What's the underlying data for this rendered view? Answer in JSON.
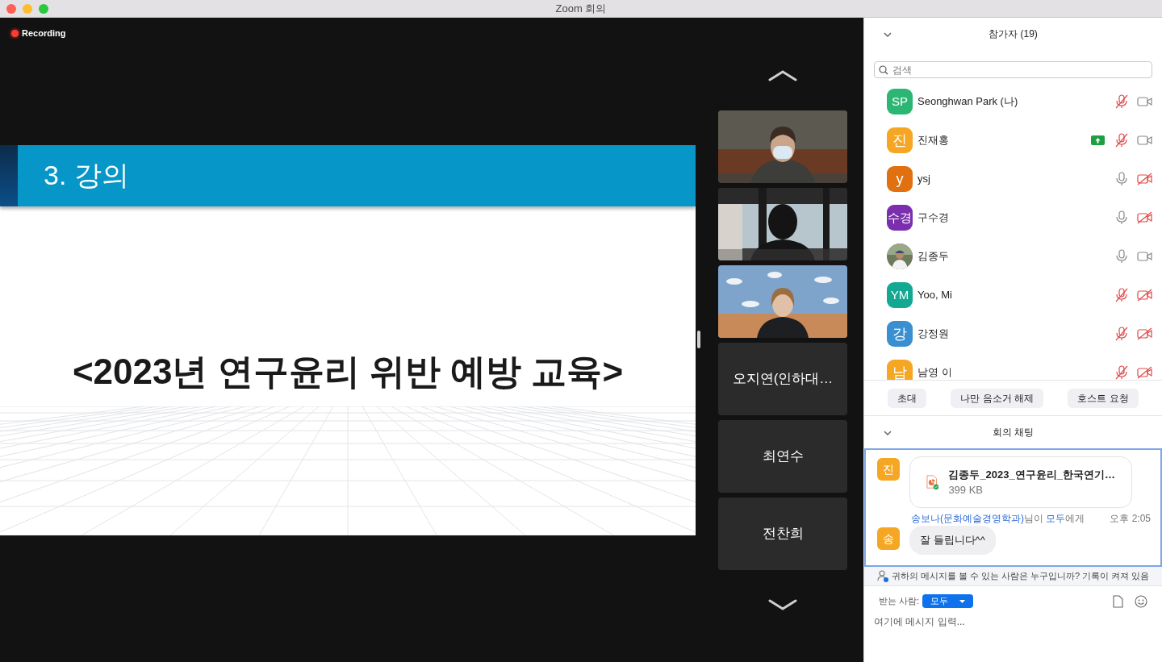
{
  "window": {
    "title": "Zoom 회의"
  },
  "recording": {
    "label": "Recording",
    "on": true
  },
  "slide": {
    "heading": "3. 강의",
    "title": "<2023년 연구윤리 위반 예방 교육>"
  },
  "video_strip": [
    {
      "kind": "picture"
    },
    {
      "kind": "picture"
    },
    {
      "kind": "picture"
    },
    {
      "kind": "name",
      "name": "오지연(인하대…"
    },
    {
      "kind": "name",
      "name": "최연수"
    },
    {
      "kind": "name",
      "name": "전찬희"
    }
  ],
  "participants_panel": {
    "title": "참가자 (19)",
    "search": {
      "placeholder": "검색"
    },
    "participants": [
      {
        "avatar": "SP",
        "color": "#2bb673",
        "name": "Seonghwan Park (나)",
        "sharing": false,
        "muted": true,
        "video": true
      },
      {
        "avatar": "진",
        "color": "#f5a623",
        "name": "진재홍",
        "sharing": true,
        "muted": true,
        "video": true
      },
      {
        "avatar": "y",
        "color": "#e07010",
        "name": "ysj",
        "sharing": false,
        "muted": false,
        "video": false
      },
      {
        "avatar": "수경",
        "color": "#7b2fae",
        "name": "구수경",
        "sharing": false,
        "muted": false,
        "video": false
      },
      {
        "kind": "picture",
        "name": "김종두",
        "sharing": false,
        "muted": false,
        "video": true
      },
      {
        "avatar": "YM",
        "color": "#13a891",
        "name": "Yoo, Mi",
        "sharing": false,
        "muted": true,
        "video": false
      },
      {
        "avatar": "강",
        "color": "#3a8fd0",
        "name": "강정원",
        "sharing": false,
        "muted": true,
        "video": false
      },
      {
        "avatar": "남",
        "color": "#f5a623",
        "name": "남영 이",
        "sharing": false,
        "muted": true,
        "video": false
      }
    ],
    "buttons": [
      "초대",
      "나만 음소거 해제",
      "호스트 요청"
    ]
  },
  "chat": {
    "title": "회의 채팅",
    "messages": [
      {
        "kind": "file",
        "avatar": "진",
        "color": "#f5a623",
        "file_name": "김종두_2023_연구윤리_한국연기…",
        "file_size": "399 KB"
      },
      {
        "kind": "text",
        "avatar": "송",
        "color": "#f5a623",
        "sender": "송보나(문화예술경영학과)",
        "sender_suffix": "님이",
        "recipient": "모두",
        "recipient_suffix": "에게",
        "time": "오후 2:05",
        "text": "잘 들립니다^^"
      }
    ],
    "notice": "귀하의 메시지를 볼 수 있는 사람은 누구입니까? 기록이 켜져 있음",
    "to_label": "받는 사람:",
    "to_value": "모두",
    "input_placeholder": "여기에 메시지 입력..."
  }
}
